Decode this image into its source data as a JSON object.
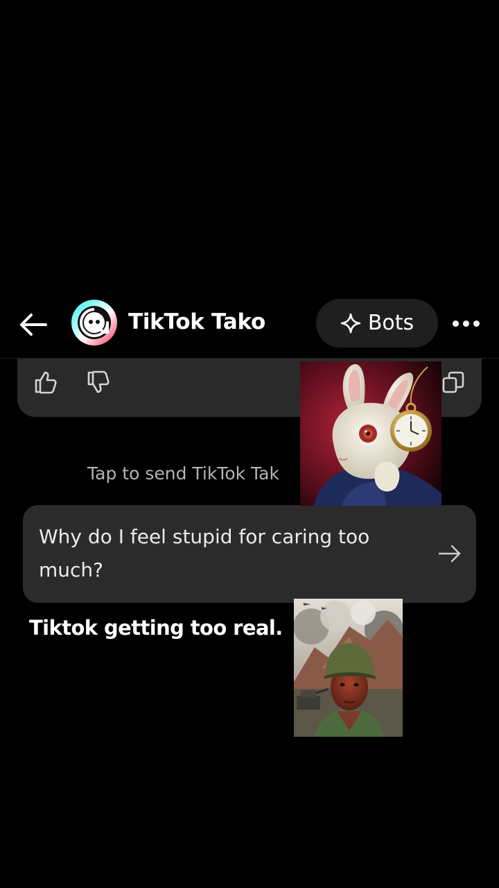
{
  "header": {
    "back_icon": "arrow-left-icon",
    "avatar_icon": "tiktok-tako-logo",
    "title": "TikTok Tako",
    "bots_icon": "sparkle-icon",
    "bots_label": "Bots",
    "more_icon": "more-dots-icon"
  },
  "message_actions": {
    "like_icon": "thumbs-up-icon",
    "dislike_icon": "thumbs-down-icon",
    "copy_icon": "copy-icon"
  },
  "tap_to_send": "Tap to send TikTok Tak",
  "suggestion": {
    "text": "Why do I feel stupid for caring too much?",
    "arrow_icon": "arrow-right-icon"
  },
  "caption": "Tiktok getting too real.",
  "colors": {
    "background": "#000000",
    "card": "#2a2a2a",
    "pill": "#1f1f1f",
    "logo_cyan": "#25f4ee",
    "logo_red": "#fe2c55"
  }
}
